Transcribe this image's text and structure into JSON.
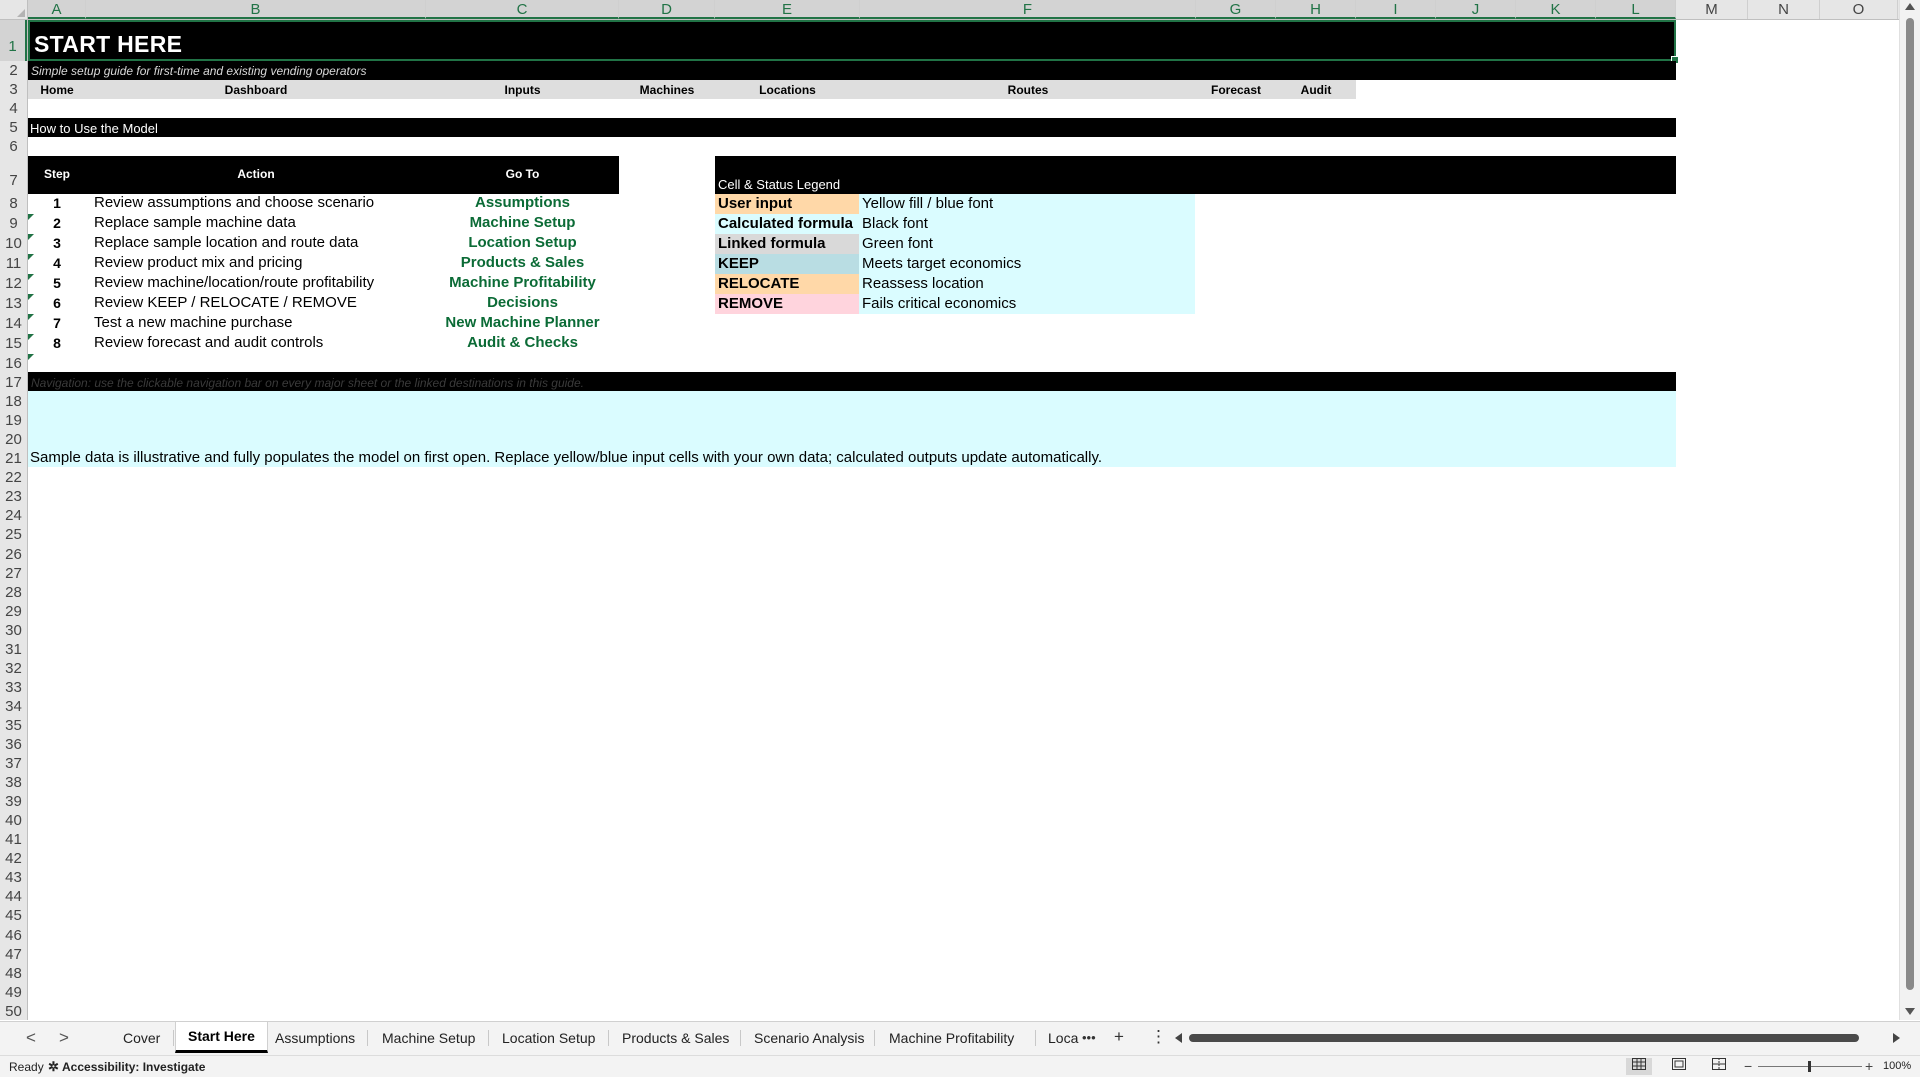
{
  "columns": [
    "A",
    "B",
    "C",
    "D",
    "E",
    "F",
    "G",
    "H",
    "I",
    "J",
    "K",
    "L",
    "M",
    "N",
    "O"
  ],
  "rows": [
    "1",
    "2",
    "3",
    "4",
    "5",
    "6",
    "7",
    "8",
    "9",
    "10",
    "11",
    "12",
    "13",
    "14",
    "15",
    "16",
    "17",
    "18",
    "19",
    "20",
    "21",
    "22",
    "23",
    "24",
    "25",
    "26",
    "27",
    "28",
    "29",
    "30",
    "31",
    "32",
    "33",
    "34",
    "35",
    "36",
    "37",
    "38",
    "39",
    "40",
    "41",
    "42",
    "43",
    "44",
    "45",
    "46",
    "47",
    "48",
    "49",
    "50"
  ],
  "sheet": {
    "title": "START HERE",
    "subtitle": "Simple setup guide for first-time and existing vending operators",
    "nav": [
      "Home",
      "Dashboard",
      "Inputs",
      "Machines",
      "Locations",
      "Routes",
      "Forecast",
      "Audit"
    ],
    "section_title": "How to Use the Model",
    "steps_table": {
      "headers": [
        "Step",
        "Action",
        "Go To"
      ],
      "rows": [
        {
          "step": "1",
          "action": "Review assumptions and choose scenario",
          "goto": "Assumptions"
        },
        {
          "step": "2",
          "action": "Replace sample machine data",
          "goto": "Machine Setup"
        },
        {
          "step": "3",
          "action": "Replace sample location and route data",
          "goto": "Location Setup"
        },
        {
          "step": "4",
          "action": "Review product mix and pricing",
          "goto": "Products & Sales"
        },
        {
          "step": "5",
          "action": "Review machine/location/route profitability",
          "goto": "Machine Profitability"
        },
        {
          "step": "6",
          "action": "Review KEEP / RELOCATE / REMOVE",
          "goto": "Decisions"
        },
        {
          "step": "7",
          "action": "Test a new machine purchase",
          "goto": "New Machine Planner"
        },
        {
          "step": "8",
          "action": "Review forecast and audit controls",
          "goto": "Audit & Checks"
        }
      ]
    },
    "legend": {
      "title": "Cell & Status Legend",
      "items": [
        {
          "label": "User input",
          "desc": "Yellow fill / blue font",
          "fill": "#ffd8a8"
        },
        {
          "label": "Calculated formula",
          "desc": "Black font",
          "fill": "#dafcff"
        },
        {
          "label": "Linked formula",
          "desc": "Green font",
          "fill": "#d9d9d9"
        },
        {
          "label": "KEEP",
          "desc": "Meets target economics",
          "fill": "#b9dde3"
        },
        {
          "label": "RELOCATE",
          "desc": "Reassess location",
          "fill": "#ffd8a8"
        },
        {
          "label": "REMOVE",
          "desc": "Fails critical economics",
          "fill": "#ffd4dd"
        }
      ]
    },
    "nav_note": "Navigation: use the clickable navigation bar on every major sheet or the linked destinations in this guide.",
    "note": "Sample data is illustrative and fully populates the model on first open. Replace yellow/blue input cells with your own data; calculated outputs update automatically."
  },
  "tabs": [
    "Cover",
    "Start Here",
    "Assumptions",
    "Machine Setup",
    "Location Setup",
    "Products & Sales",
    "Scenario Analysis",
    "Machine Profitability",
    "Loca"
  ],
  "active_tab": "Start Here",
  "tab_controls": {
    "prev": "<",
    "next": ">",
    "more": "•••",
    "add": "+",
    "options": "⋮"
  },
  "status": {
    "ready": "Ready",
    "accessibility": "Accessibility: Investigate",
    "zoom": "100%",
    "zoom_minus": "−",
    "zoom_plus": "+"
  },
  "colors": {
    "accent": "#217346",
    "link_green": "#0b6b36",
    "note_fill": "#dafcff"
  }
}
